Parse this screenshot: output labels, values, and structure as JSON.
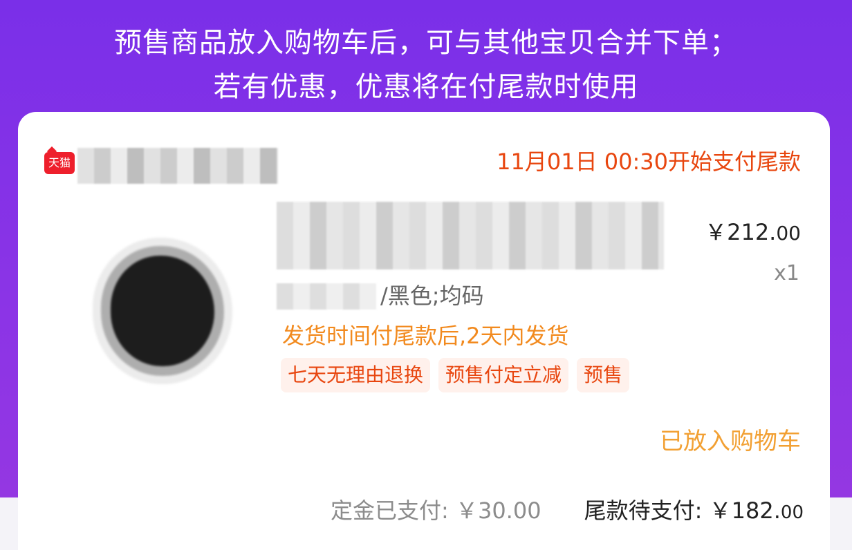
{
  "banner": {
    "line1": "预售商品放入购物车后，可与其他宝贝合并下单；",
    "line2": "若有优惠，优惠将在付尾款时使用"
  },
  "order": {
    "shop_badge": "天猫",
    "pay_start": "11月01日 00:30开始支付尾款",
    "variant": "/黑色;均码",
    "price_main": "￥212.",
    "price_cents": "00",
    "quantity": "x1",
    "shipping": "发货时间付尾款后,2天内发货",
    "tags": [
      "七天无理由退换",
      "预售付定立减",
      "预售"
    ],
    "cart_status": "已放入购物车",
    "deposit_label": "定金已支付: ￥30.00",
    "balance_label": "尾款待支付: ",
    "balance_main": "￥182.",
    "balance_cents": "00"
  },
  "icons": {
    "shop_logo": "tmall-logo-icon"
  },
  "colors": {
    "banner": "#8233e6",
    "accent_red": "#e8460f",
    "accent_orange": "#f2a033",
    "tag_bg": "#fff1ec"
  }
}
